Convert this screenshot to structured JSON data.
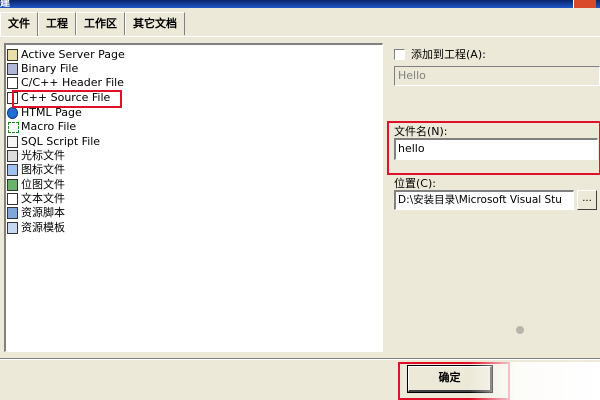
{
  "window": {
    "title": "建"
  },
  "tabs": [
    {
      "label": "文件",
      "active": true
    },
    {
      "label": "工程",
      "active": false
    },
    {
      "label": "工作区",
      "active": false
    },
    {
      "label": "其它文档",
      "active": false
    }
  ],
  "file_types": [
    {
      "label": "Active Server Page",
      "icon": "asp-file-icon"
    },
    {
      "label": "Binary File",
      "icon": "binary-file-icon"
    },
    {
      "label": "C/C++ Header File",
      "icon": "header-file-icon"
    },
    {
      "label": "C++ Source File",
      "icon": "cpp-source-icon"
    },
    {
      "label": "HTML Page",
      "icon": "html-page-icon"
    },
    {
      "label": "Macro File",
      "icon": "macro-file-icon"
    },
    {
      "label": "SQL Script File",
      "icon": "sql-script-icon"
    },
    {
      "label": "光标文件",
      "icon": "cursor-file-icon"
    },
    {
      "label": "图标文件",
      "icon": "icon-file-icon"
    },
    {
      "label": "位图文件",
      "icon": "bitmap-file-icon"
    },
    {
      "label": "文本文件",
      "icon": "text-file-icon"
    },
    {
      "label": "资源脚本",
      "icon": "resource-script-icon"
    },
    {
      "label": "资源模板",
      "icon": "resource-template-icon"
    }
  ],
  "form": {
    "add_to_project_label": "添加到工程(A):",
    "add_to_project_checked": false,
    "project_value": "Hello",
    "filename_label": "文件名(N):",
    "filename_value": "hello",
    "location_label": "位置(C):",
    "location_value": "D:\\安装目录\\Microsoft Visual Stu",
    "browse_label": "..."
  },
  "buttons": {
    "ok_label": "确定"
  },
  "colors": {
    "highlight": "#e0102a",
    "dialog_bg": "#ece9d8"
  }
}
